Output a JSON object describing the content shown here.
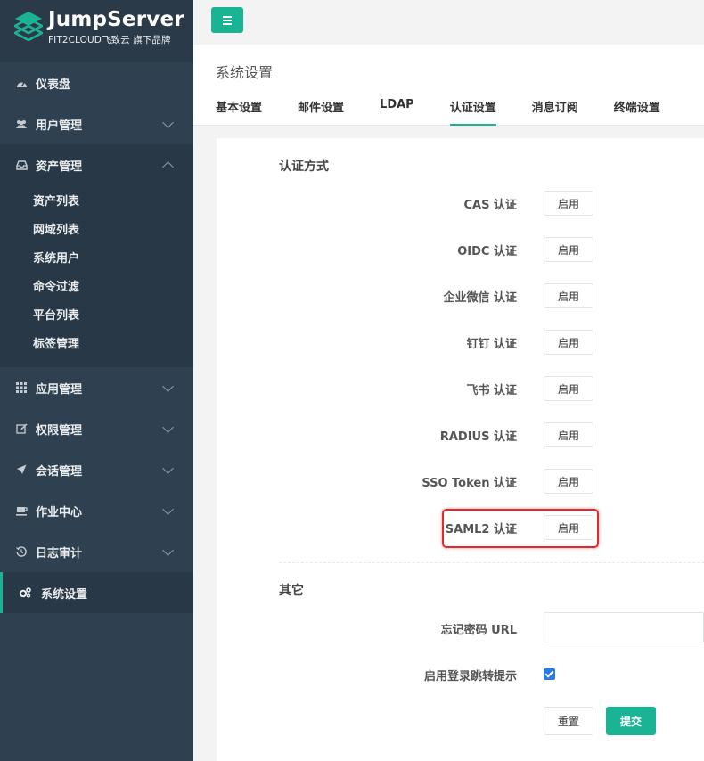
{
  "brand": {
    "name": "JumpServer",
    "subtitle": "FIT2CLOUD飞致云 旗下品牌"
  },
  "sidebar": {
    "items": [
      {
        "label": "仪表盘",
        "icon": "dashboard-icon"
      },
      {
        "label": "用户管理",
        "icon": "users-icon"
      },
      {
        "label": "资产管理",
        "icon": "inbox-icon",
        "expanded": true,
        "children": [
          "资产列表",
          "网域列表",
          "系统用户",
          "命令过滤",
          "平台列表",
          "标签管理"
        ]
      },
      {
        "label": "应用管理",
        "icon": "grid-icon"
      },
      {
        "label": "权限管理",
        "icon": "edit-icon"
      },
      {
        "label": "会话管理",
        "icon": "rocket-icon"
      },
      {
        "label": "作业中心",
        "icon": "coffee-icon"
      },
      {
        "label": "日志审计",
        "icon": "history-icon"
      },
      {
        "label": "系统设置",
        "icon": "gears-icon",
        "active": true
      }
    ]
  },
  "header": {
    "title": "系统设置",
    "tabs": [
      "基本设置",
      "邮件设置",
      "LDAP",
      "认证设置",
      "消息订阅",
      "终端设置"
    ],
    "active_tab": "认证设置"
  },
  "auth": {
    "section_title": "认证方式",
    "methods": [
      "CAS 认证",
      "OIDC 认证",
      "企业微信 认证",
      "钉钉 认证",
      "飞书 认证",
      "RADIUS 认证",
      "SSO Token 认证",
      "SAML2 认证"
    ],
    "enable_label": "启用",
    "highlighted": "SAML2 认证"
  },
  "other": {
    "section_title": "其它",
    "forgot_password_label": "忘记密码 URL",
    "forgot_password_value": "",
    "login_redirect_label": "启用登录跳转提示",
    "login_redirect_checked": true
  },
  "actions": {
    "reset_label": "重置",
    "submit_label": "提交"
  },
  "colors": {
    "sidebar": "#2f4050",
    "accent": "#1ab394",
    "highlight": "#e12a2a",
    "checkbox": "#2c7be5"
  }
}
